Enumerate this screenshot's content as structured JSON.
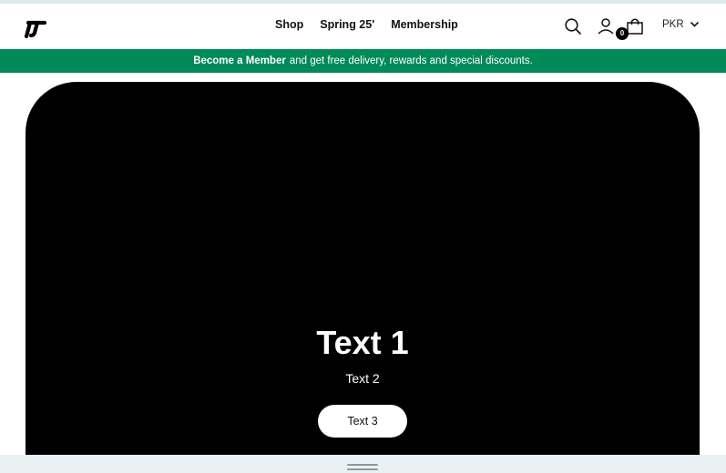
{
  "header": {
    "nav": [
      {
        "label": "Shop"
      },
      {
        "label": "Spring 25'"
      },
      {
        "label": "Membership"
      }
    ],
    "cart_count": "0",
    "currency": "PKR",
    "logo_icon": "brand-logo",
    "icons": [
      "search-icon",
      "account-icon",
      "shopping-bag-icon",
      "chevron-down-icon"
    ]
  },
  "promo": {
    "bold": "Become a Member",
    "rest": "and get free delivery, rewards and special discounts.",
    "background": "#008a5a"
  },
  "hero": {
    "title": "Text 1",
    "subtitle": "Text 2",
    "button_label": "Text 3",
    "background": "#000000"
  }
}
